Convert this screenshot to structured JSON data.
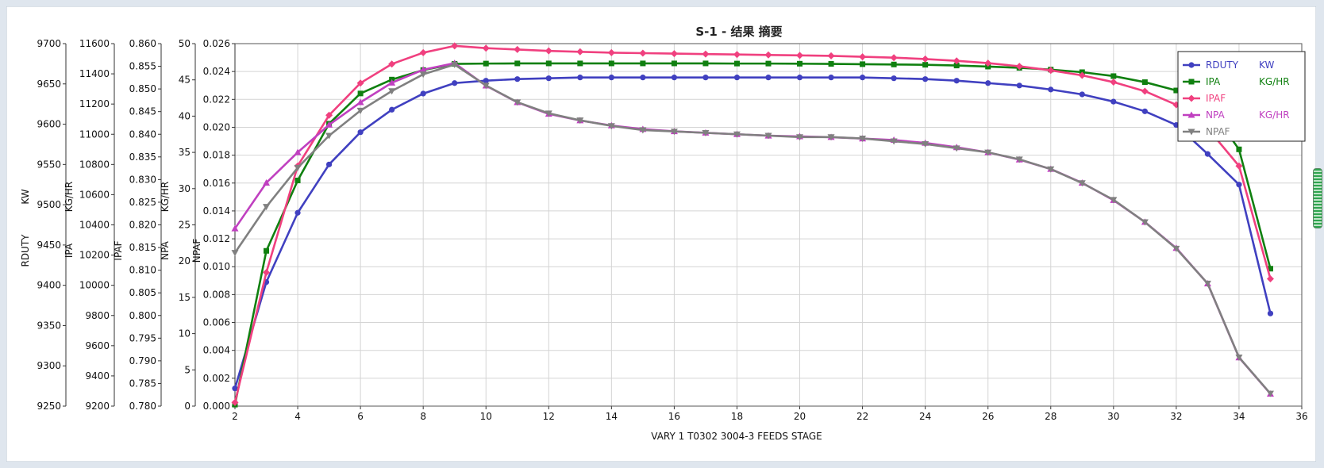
{
  "chart_data": {
    "type": "line",
    "title": "S-1 - 结果 摘要",
    "xlabel": "VARY   1 T0302    3004-3   FEEDS    STAGE",
    "xlim": [
      2,
      36
    ],
    "xticks": [
      "2",
      "4",
      "6",
      "8",
      "10",
      "12",
      "14",
      "16",
      "18",
      "20",
      "22",
      "24",
      "26",
      "28",
      "30",
      "32",
      "34",
      "36"
    ],
    "x": [
      2,
      3,
      4,
      5,
      6,
      7,
      8,
      9,
      10,
      11,
      12,
      13,
      14,
      15,
      16,
      17,
      18,
      19,
      20,
      21,
      22,
      23,
      24,
      25,
      26,
      27,
      28,
      29,
      30,
      31,
      32,
      33,
      34,
      35
    ],
    "axes": [
      {
        "key": "rduty",
        "name": "RDUTY",
        "unit": "KW",
        "lim": [
          9250,
          9700
        ],
        "ticks": [
          "9250",
          "9300",
          "9350",
          "9400",
          "9450",
          "9500",
          "9550",
          "9600",
          "9650",
          "9700"
        ]
      },
      {
        "key": "ipa",
        "name": "IPA",
        "unit": "KG/HR",
        "lim": [
          9200,
          11600
        ],
        "ticks": [
          "9200",
          "9400",
          "9600",
          "9800",
          "10000",
          "10200",
          "10400",
          "10600",
          "10800",
          "11000",
          "11200",
          "11400",
          "11600"
        ]
      },
      {
        "key": "ipaf",
        "name": "IPAF",
        "unit": "",
        "lim": [
          0.78,
          0.86
        ],
        "ticks": [
          "0.780",
          "0.785",
          "0.790",
          "0.795",
          "0.800",
          "0.805",
          "0.810",
          "0.815",
          "0.820",
          "0.825",
          "0.830",
          "0.835",
          "0.840",
          "0.845",
          "0.850",
          "0.855",
          "0.860"
        ]
      },
      {
        "key": "npa",
        "name": "NPA",
        "unit": "KG/HR",
        "lim": [
          0,
          50
        ],
        "ticks": [
          "0",
          "5",
          "10",
          "15",
          "20",
          "25",
          "30",
          "35",
          "40",
          "45",
          "50"
        ]
      },
      {
        "key": "npaf",
        "name": "NPAF",
        "unit": "",
        "lim": [
          0,
          0.026
        ],
        "ticks": [
          "0.000",
          "0.002",
          "0.004",
          "0.006",
          "0.008",
          "0.010",
          "0.012",
          "0.014",
          "0.016",
          "0.018",
          "0.020",
          "0.022",
          "0.024",
          "0.026"
        ]
      }
    ],
    "series": [
      {
        "name": "RDUTY",
        "unit": "KW",
        "color": "#4040c0",
        "marker": "circle",
        "axis": "rduty",
        "values": [
          9272,
          9404,
          9490,
          9550,
          9590,
          9618,
          9638,
          9651,
          9654,
          9656,
          9657,
          9658,
          9658,
          9658,
          9658,
          9658,
          9658,
          9658,
          9658,
          9658,
          9658,
          9657,
          9656,
          9654,
          9651,
          9648,
          9643,
          9637,
          9628,
          9616,
          9599,
          9563,
          9525,
          9365
        ]
      },
      {
        "name": "IPA",
        "unit": "KG/HR",
        "color": "#108010",
        "marker": "square",
        "axis": "ipa",
        "values": [
          9210,
          10228,
          10694,
          11070,
          11270,
          11362,
          11425,
          11466,
          11468,
          11469,
          11469,
          11469,
          11469,
          11469,
          11469,
          11469,
          11468,
          11468,
          11467,
          11466,
          11464,
          11462,
          11460,
          11455,
          11448,
          11440,
          11428,
          11411,
          11385,
          11345,
          11290,
          11190,
          10900,
          10110
        ]
      },
      {
        "name": "IPAF",
        "unit": "",
        "color": "#f0407f",
        "marker": "diamond",
        "axis": "ipaf",
        "values": [
          0.7808,
          0.8095,
          0.833,
          0.8442,
          0.8513,
          0.8555,
          0.858,
          0.8595,
          0.859,
          0.8587,
          0.8584,
          0.8582,
          0.858,
          0.8579,
          0.8578,
          0.8577,
          0.8576,
          0.8575,
          0.8574,
          0.8573,
          0.8571,
          0.8569,
          0.8566,
          0.8562,
          0.8557,
          0.855,
          0.8541,
          0.853,
          0.8515,
          0.8495,
          0.8465,
          0.8413,
          0.833,
          0.8081
        ]
      },
      {
        "name": "NPA",
        "unit": "KG/HR",
        "color": "#c040c0",
        "marker": "triangle-up",
        "axis": "npa",
        "values": [
          24.5,
          30.8,
          35.0,
          38.8,
          41.9,
          44.6,
          46.4,
          47.3,
          44.2,
          41.9,
          40.3,
          39.4,
          38.7,
          38.2,
          37.9,
          37.7,
          37.5,
          37.3,
          37.2,
          37.1,
          36.9,
          36.7,
          36.3,
          35.7,
          35.0,
          34.0,
          32.7,
          30.8,
          28.4,
          25.4,
          21.8,
          16.9,
          6.7,
          1.7
        ]
      },
      {
        "name": "NPAF",
        "unit": "",
        "color": "#808080",
        "marker": "triangle-down",
        "axis": "npaf",
        "values": [
          0.011,
          0.0143,
          0.0171,
          0.0194,
          0.0212,
          0.0226,
          0.0238,
          0.0245,
          0.023,
          0.0218,
          0.021,
          0.0205,
          0.0201,
          0.0198,
          0.0197,
          0.0196,
          0.0195,
          0.0194,
          0.0193,
          0.0193,
          0.0192,
          0.019,
          0.0188,
          0.0185,
          0.0182,
          0.0177,
          0.017,
          0.016,
          0.0148,
          0.0132,
          0.0113,
          0.0088,
          0.0035,
          0.0009
        ]
      }
    ],
    "grid": true,
    "legend_position": "top-right"
  }
}
